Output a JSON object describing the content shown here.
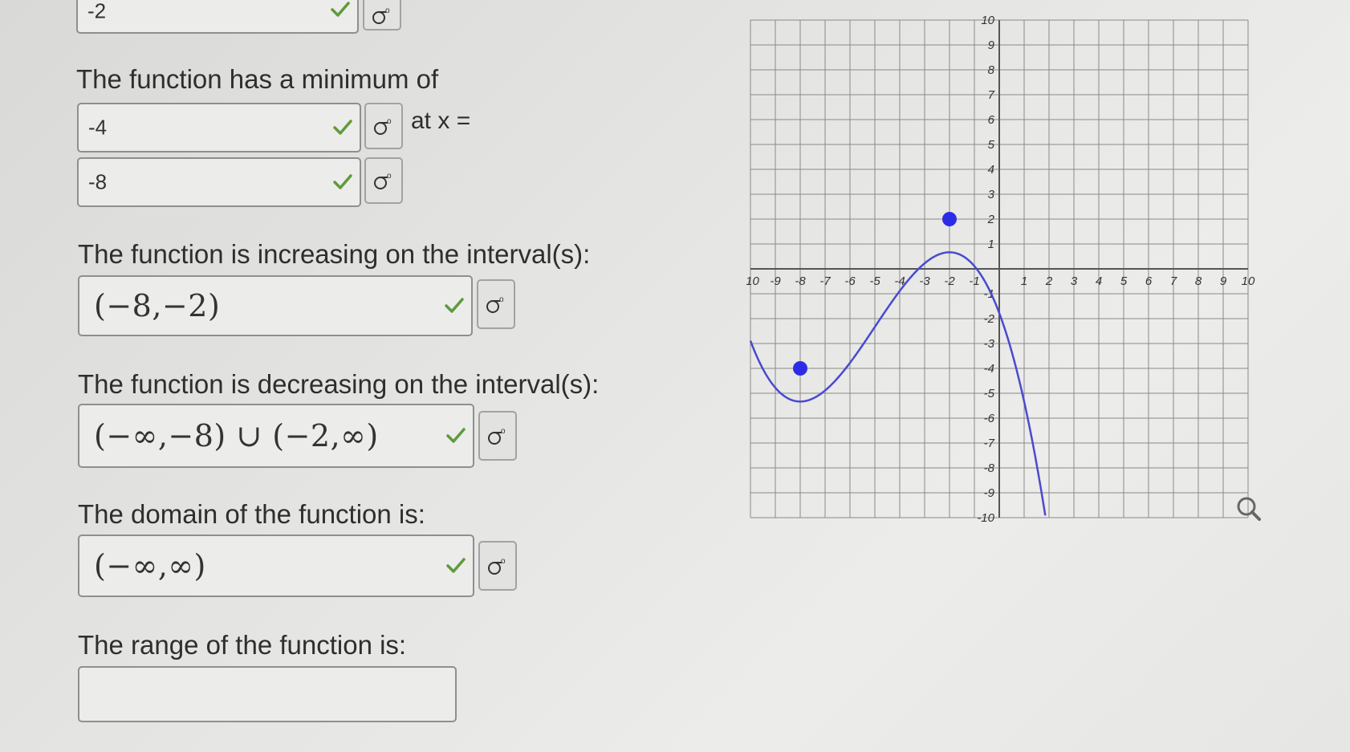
{
  "top_answer": {
    "value": "-2"
  },
  "minimum": {
    "label": "The function has a minimum of",
    "value": "-4",
    "at_label": "at x =",
    "x_value": "-8"
  },
  "increasing": {
    "label": "The function is increasing on the interval(s):",
    "value": "(−8,−2)"
  },
  "decreasing": {
    "label": "The function is decreasing on the interval(s):",
    "value": "(−∞,−8) ∪ (−2,∞)"
  },
  "domain": {
    "label": "The domain of the function is:",
    "value": "(−∞,∞)"
  },
  "range": {
    "label": "The range of the function is:",
    "value": ""
  },
  "colors": {
    "check": "#5f9a3c",
    "curve": "#4a4ad0",
    "point": "#2c2ce8",
    "grid": "#8a8a8a",
    "axis": "#555555"
  },
  "icons": {
    "check": "check-icon",
    "equation_editor": "equation-editor-icon",
    "magnifier": "magnifier-icon"
  },
  "graph": {
    "x_ticks": [
      "-10",
      "-9",
      "-8",
      "-7",
      "-6",
      "-5",
      "-4",
      "-3",
      "-2",
      "-1",
      "1",
      "2",
      "3",
      "4",
      "5",
      "6",
      "7",
      "8",
      "9",
      "10"
    ],
    "y_ticks": [
      "10",
      "9",
      "8",
      "7",
      "6",
      "5",
      "4",
      "3",
      "2",
      "1",
      "-1",
      "-2",
      "-3",
      "-4",
      "-5",
      "-6",
      "-7",
      "-8",
      "-9",
      "-10"
    ],
    "x_range": [
      -10,
      10
    ],
    "y_range": [
      -10,
      10
    ],
    "marked_points": [
      {
        "x": -8,
        "y": -4
      },
      {
        "x": -2,
        "y": 2
      }
    ]
  }
}
